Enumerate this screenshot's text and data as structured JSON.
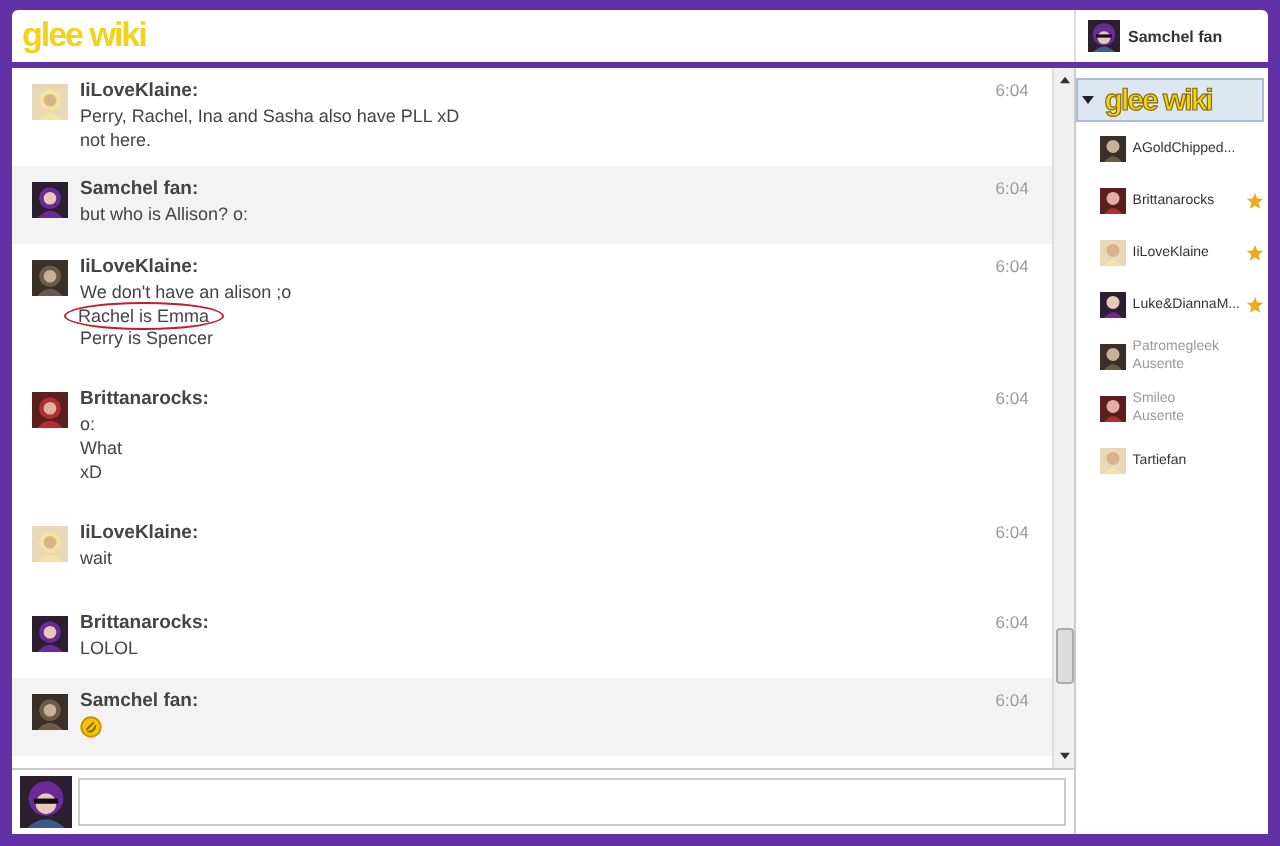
{
  "header": {
    "logo": "glee wiki",
    "user": {
      "name": "Samchel fan"
    }
  },
  "messages": [
    {
      "author": "IiLoveKlaine:",
      "time": "6:04",
      "highlighted": false,
      "lines": [
        {
          "kind": "text",
          "text": "Perry, Rachel, Ina and Sasha also have PLL xD",
          "circled": false
        },
        {
          "kind": "text",
          "text": "not here.",
          "circled": false
        }
      ]
    },
    {
      "author": "Samchel fan:",
      "time": "6:04",
      "highlighted": true,
      "lines": [
        {
          "kind": "text",
          "text": "but who is Allison? o:",
          "circled": false
        }
      ]
    },
    {
      "author": "IiLoveKlaine:",
      "time": "6:04",
      "highlighted": false,
      "lines": [
        {
          "kind": "text",
          "text": "We don't have an alison ;o",
          "circled": false
        },
        {
          "kind": "text",
          "text": "Rachel is Emma",
          "circled": true
        },
        {
          "kind": "text",
          "text": "Perry is Spencer",
          "circled": false
        }
      ]
    },
    {
      "author": "Brittanarocks:",
      "time": "6:04",
      "highlighted": false,
      "lines": [
        {
          "kind": "text",
          "text": "o:",
          "circled": false
        },
        {
          "kind": "text",
          "text": "What",
          "circled": false
        },
        {
          "kind": "text",
          "text": "xD",
          "circled": false
        }
      ]
    },
    {
      "author": "IiLoveKlaine:",
      "time": "6:04",
      "highlighted": false,
      "lines": [
        {
          "kind": "text",
          "text": "wait",
          "circled": false
        }
      ]
    },
    {
      "author": "Brittanarocks:",
      "time": "6:04",
      "highlighted": false,
      "lines": [
        {
          "kind": "text",
          "text": "LOLOL",
          "circled": false
        }
      ]
    },
    {
      "author": "Samchel fan:",
      "time": "6:04",
      "highlighted": true,
      "lines": [
        {
          "kind": "emoji"
        }
      ]
    }
  ],
  "sidebar": {
    "title": "glee wiki",
    "expanded": true,
    "users": [
      {
        "name": "AGoldChipped...",
        "starred": false,
        "away": false
      },
      {
        "name": "Brittanarocks",
        "starred": true,
        "away": false
      },
      {
        "name": "IiLoveKlaine",
        "starred": true,
        "away": false
      },
      {
        "name": "Luke&DiannaM...",
        "starred": true,
        "away": false
      },
      {
        "name": "Patromegleek",
        "status": "Ausente",
        "starred": false,
        "away": true
      },
      {
        "name": "Smileo",
        "status": "Ausente",
        "starred": false,
        "away": true
      },
      {
        "name": "Tartiefan",
        "starred": false,
        "away": false
      }
    ]
  }
}
